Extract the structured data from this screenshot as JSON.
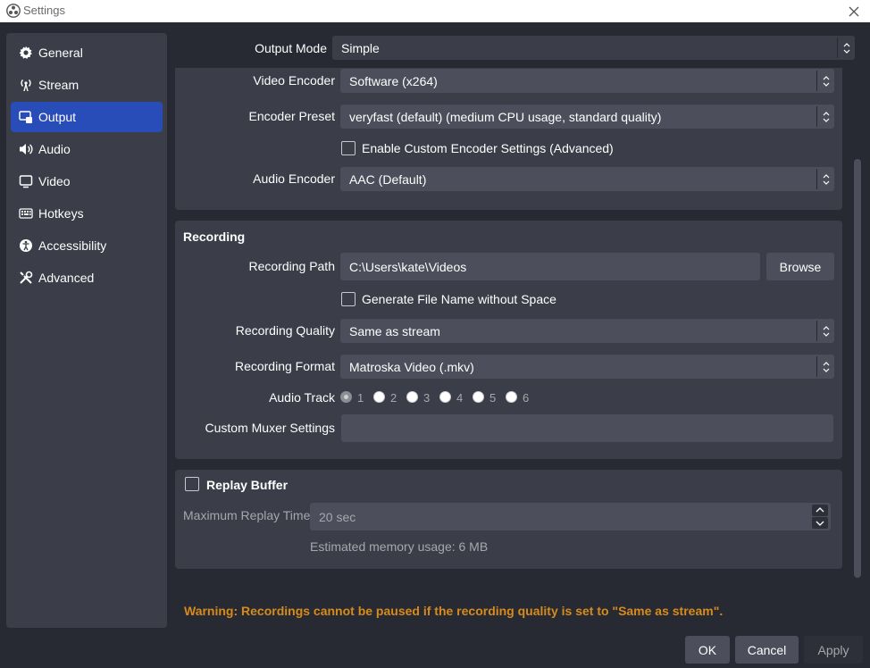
{
  "window": {
    "title": "Settings",
    "app_icon": "obs-logo-icon",
    "close_icon": "close-icon"
  },
  "sidebar": {
    "items": [
      {
        "label": "General",
        "icon": "gear-icon",
        "active": false
      },
      {
        "label": "Stream",
        "icon": "antenna-icon",
        "active": false
      },
      {
        "label": "Output",
        "icon": "output-icon",
        "active": true
      },
      {
        "label": "Audio",
        "icon": "speaker-icon",
        "active": false
      },
      {
        "label": "Video",
        "icon": "monitor-icon",
        "active": false
      },
      {
        "label": "Hotkeys",
        "icon": "keyboard-icon",
        "active": false
      },
      {
        "label": "Accessibility",
        "icon": "accessibility-icon",
        "active": false
      },
      {
        "label": "Advanced",
        "icon": "tools-icon",
        "active": false
      }
    ]
  },
  "output_mode": {
    "label": "Output Mode",
    "value": "Simple"
  },
  "streaming": {
    "video_encoder_label": "Video Encoder",
    "video_encoder_value": "Software (x264)",
    "encoder_preset_label": "Encoder Preset",
    "encoder_preset_value": "veryfast (default) (medium CPU usage, standard quality)",
    "custom_encoder_label": "Enable Custom Encoder Settings (Advanced)",
    "custom_encoder_checked": false,
    "audio_encoder_label": "Audio Encoder",
    "audio_encoder_value": "AAC (Default)"
  },
  "recording": {
    "title": "Recording",
    "path_label": "Recording Path",
    "path_value": "C:\\Users\\kate\\Videos",
    "browse_label": "Browse",
    "filename_label": "Generate File Name without Space",
    "filename_checked": false,
    "quality_label": "Recording Quality",
    "quality_value": "Same as stream",
    "format_label": "Recording Format",
    "format_value": "Matroska Video (.mkv)",
    "audio_track_label": "Audio Track",
    "audio_tracks": [
      "1",
      "2",
      "3",
      "4",
      "5",
      "6"
    ],
    "audio_track_selected": "1",
    "muxer_label": "Custom Muxer Settings",
    "muxer_value": ""
  },
  "replay_buffer": {
    "title": "Replay Buffer",
    "checked": false,
    "max_time_label": "Maximum Replay Time",
    "max_time_value": "20 sec",
    "memory_usage": "Estimated memory usage: 6 MB"
  },
  "warning": "Warning: Recordings cannot be paused if the recording quality is set to \"Same as stream\".",
  "buttons": {
    "ok": "OK",
    "cancel": "Cancel",
    "apply": "Apply"
  },
  "colors": {
    "accent": "#284cb8",
    "warning": "#d68b1c",
    "background": "#272a33",
    "panel": "#3b3e48"
  }
}
